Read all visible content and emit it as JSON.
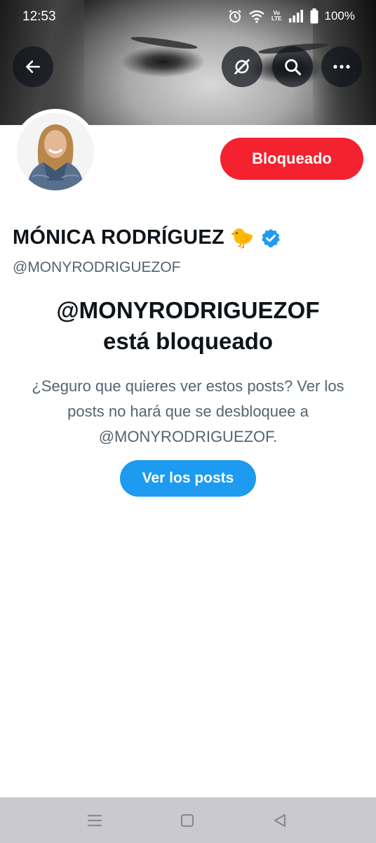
{
  "status_bar": {
    "time": "12:53",
    "network_label": "Vo\nLTE",
    "battery_text": "100%",
    "icons": [
      "alarm-icon",
      "wifi-icon",
      "volte-icon",
      "signal-icon",
      "battery-icon"
    ]
  },
  "header": {
    "icons": [
      "back-arrow-icon",
      "grok-icon",
      "search-icon",
      "more-icon"
    ]
  },
  "profile": {
    "display_name": "MÓNICA RODRÍGUEZ",
    "name_emoji": "🐤",
    "handle": "@MONYRODRIGUEZOF",
    "blocked_button_label": "Bloqueado",
    "verified_color": "#1d9bf0",
    "blocked_color": "#f4212e"
  },
  "blocked_notice": {
    "title_line1": "@MONYRODRIGUEZOF",
    "title_line2": "está bloqueado",
    "description": "¿Seguro que quieres ver estos posts? Ver los posts no hará que se desbloquee a @MONYRODRIGUEZOF.",
    "view_posts_label": "Ver los posts",
    "button_color": "#1d9bf0"
  },
  "nav_bar": {
    "icons": [
      "recent-apps-icon",
      "home-icon",
      "back-icon"
    ]
  }
}
